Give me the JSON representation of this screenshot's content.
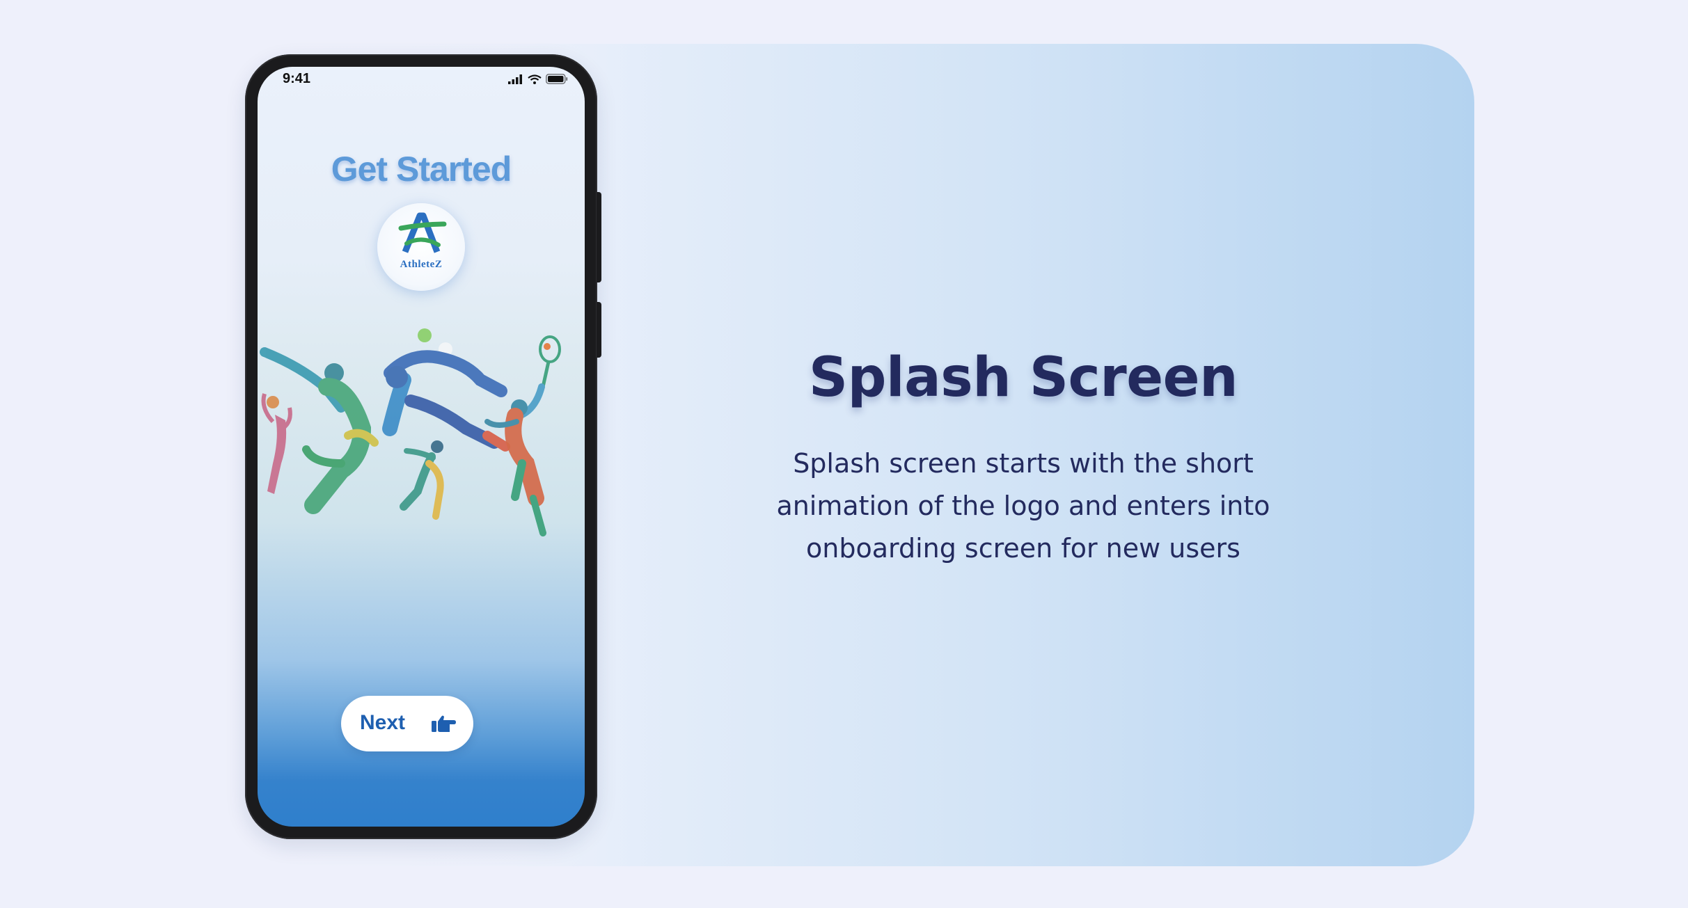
{
  "phone": {
    "status_time": "9:41",
    "title": "Get Started",
    "logo_text": "AthleteZ",
    "next_label": "Next",
    "icons": {
      "signal": "signal-icon",
      "wifi": "wifi-icon",
      "battery": "battery-icon",
      "next": "hand-pointing-right-icon",
      "logo": "athletez-logo"
    }
  },
  "info": {
    "heading": "Splash Screen",
    "description": "Splash screen starts with the short animation of the logo and enters into onboarding screen for new users"
  },
  "colors": {
    "background": "#eef0fb",
    "panel_end": "#b4d3f0",
    "heading": "#232a5e",
    "accent": "#2f7fcc",
    "button_text": "#1e5fb0"
  }
}
